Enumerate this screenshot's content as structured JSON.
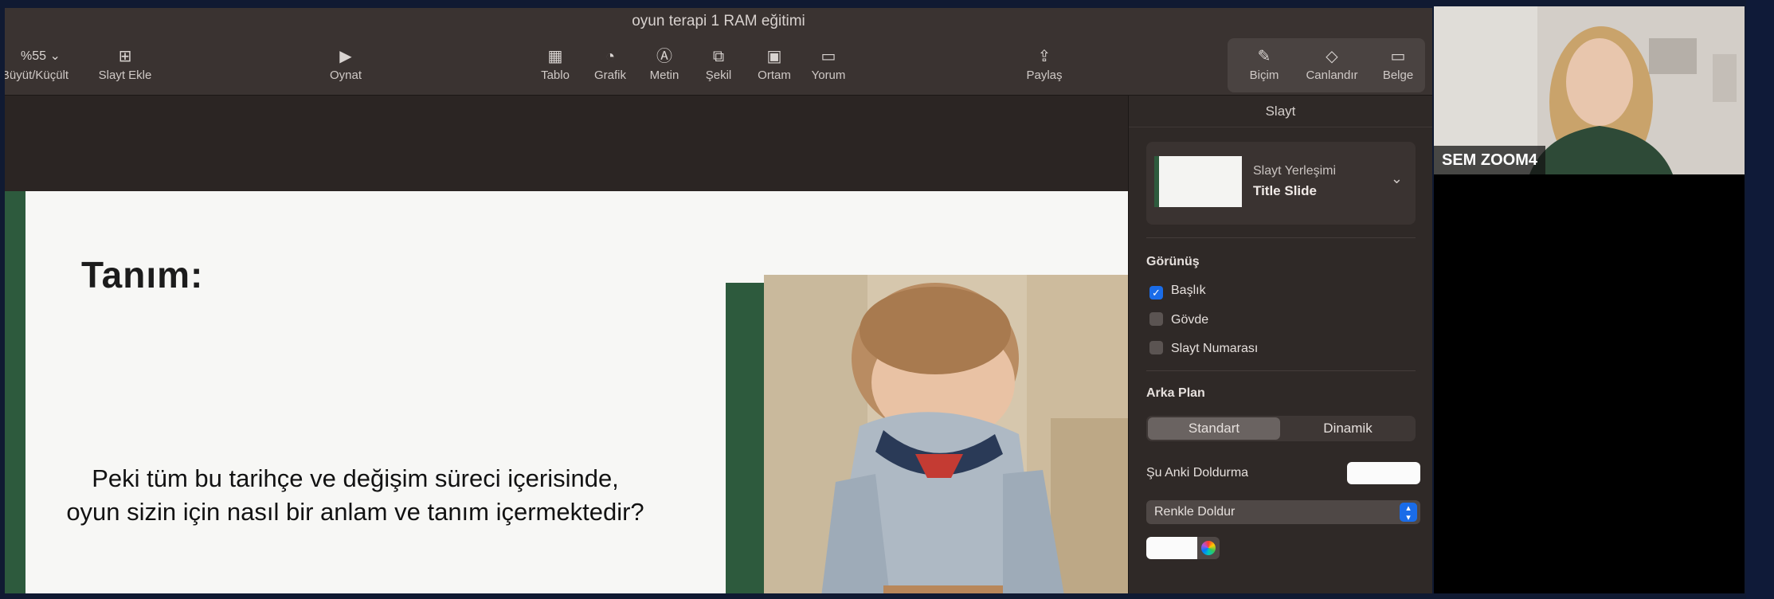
{
  "window": {
    "title": "oyun terapi 1 RAM eğitimi"
  },
  "toolbar": {
    "zoom_value": "%55",
    "zoom_label": "Büyüt/Küçült",
    "add_slide_label": "Slayt Ekle",
    "play_label": "Oynat",
    "table_label": "Tablo",
    "chart_label": "Grafik",
    "text_label": "Metin",
    "shape_label": "Şekil",
    "media_label": "Ortam",
    "comment_label": "Yorum",
    "share_label": "Paylaş",
    "format_label": "Biçim",
    "animate_label": "Canlandır",
    "document_label": "Belge"
  },
  "slide": {
    "title": "Tanım:",
    "body_line1": "Peki tüm bu tarihçe ve değişim süreci içerisinde,",
    "body_line2": "oyun sizin için nasıl bir anlam ve tanım içermektedir?"
  },
  "inspector": {
    "header": "Slayt",
    "layout_label": "Slayt Yerleşimi",
    "layout_value": "Title Slide",
    "appearance_title": "Görünüş",
    "checkboxes": [
      {
        "label": "Başlık",
        "checked": true
      },
      {
        "label": "Gövde",
        "checked": false
      },
      {
        "label": "Slayt Numarası",
        "checked": false
      }
    ],
    "background_title": "Arka Plan",
    "segments": [
      "Standart",
      "Dinamik"
    ],
    "current_fill_label": "Şu Anki Doldurma",
    "fill_select_value": "Renkle Doldur"
  },
  "participant": {
    "name": "SEM ZOOM4"
  },
  "colors": {
    "accent_green": "#2d5a3d",
    "accent_blue": "#1a6ce8",
    "window_bg": "#2b2523"
  }
}
